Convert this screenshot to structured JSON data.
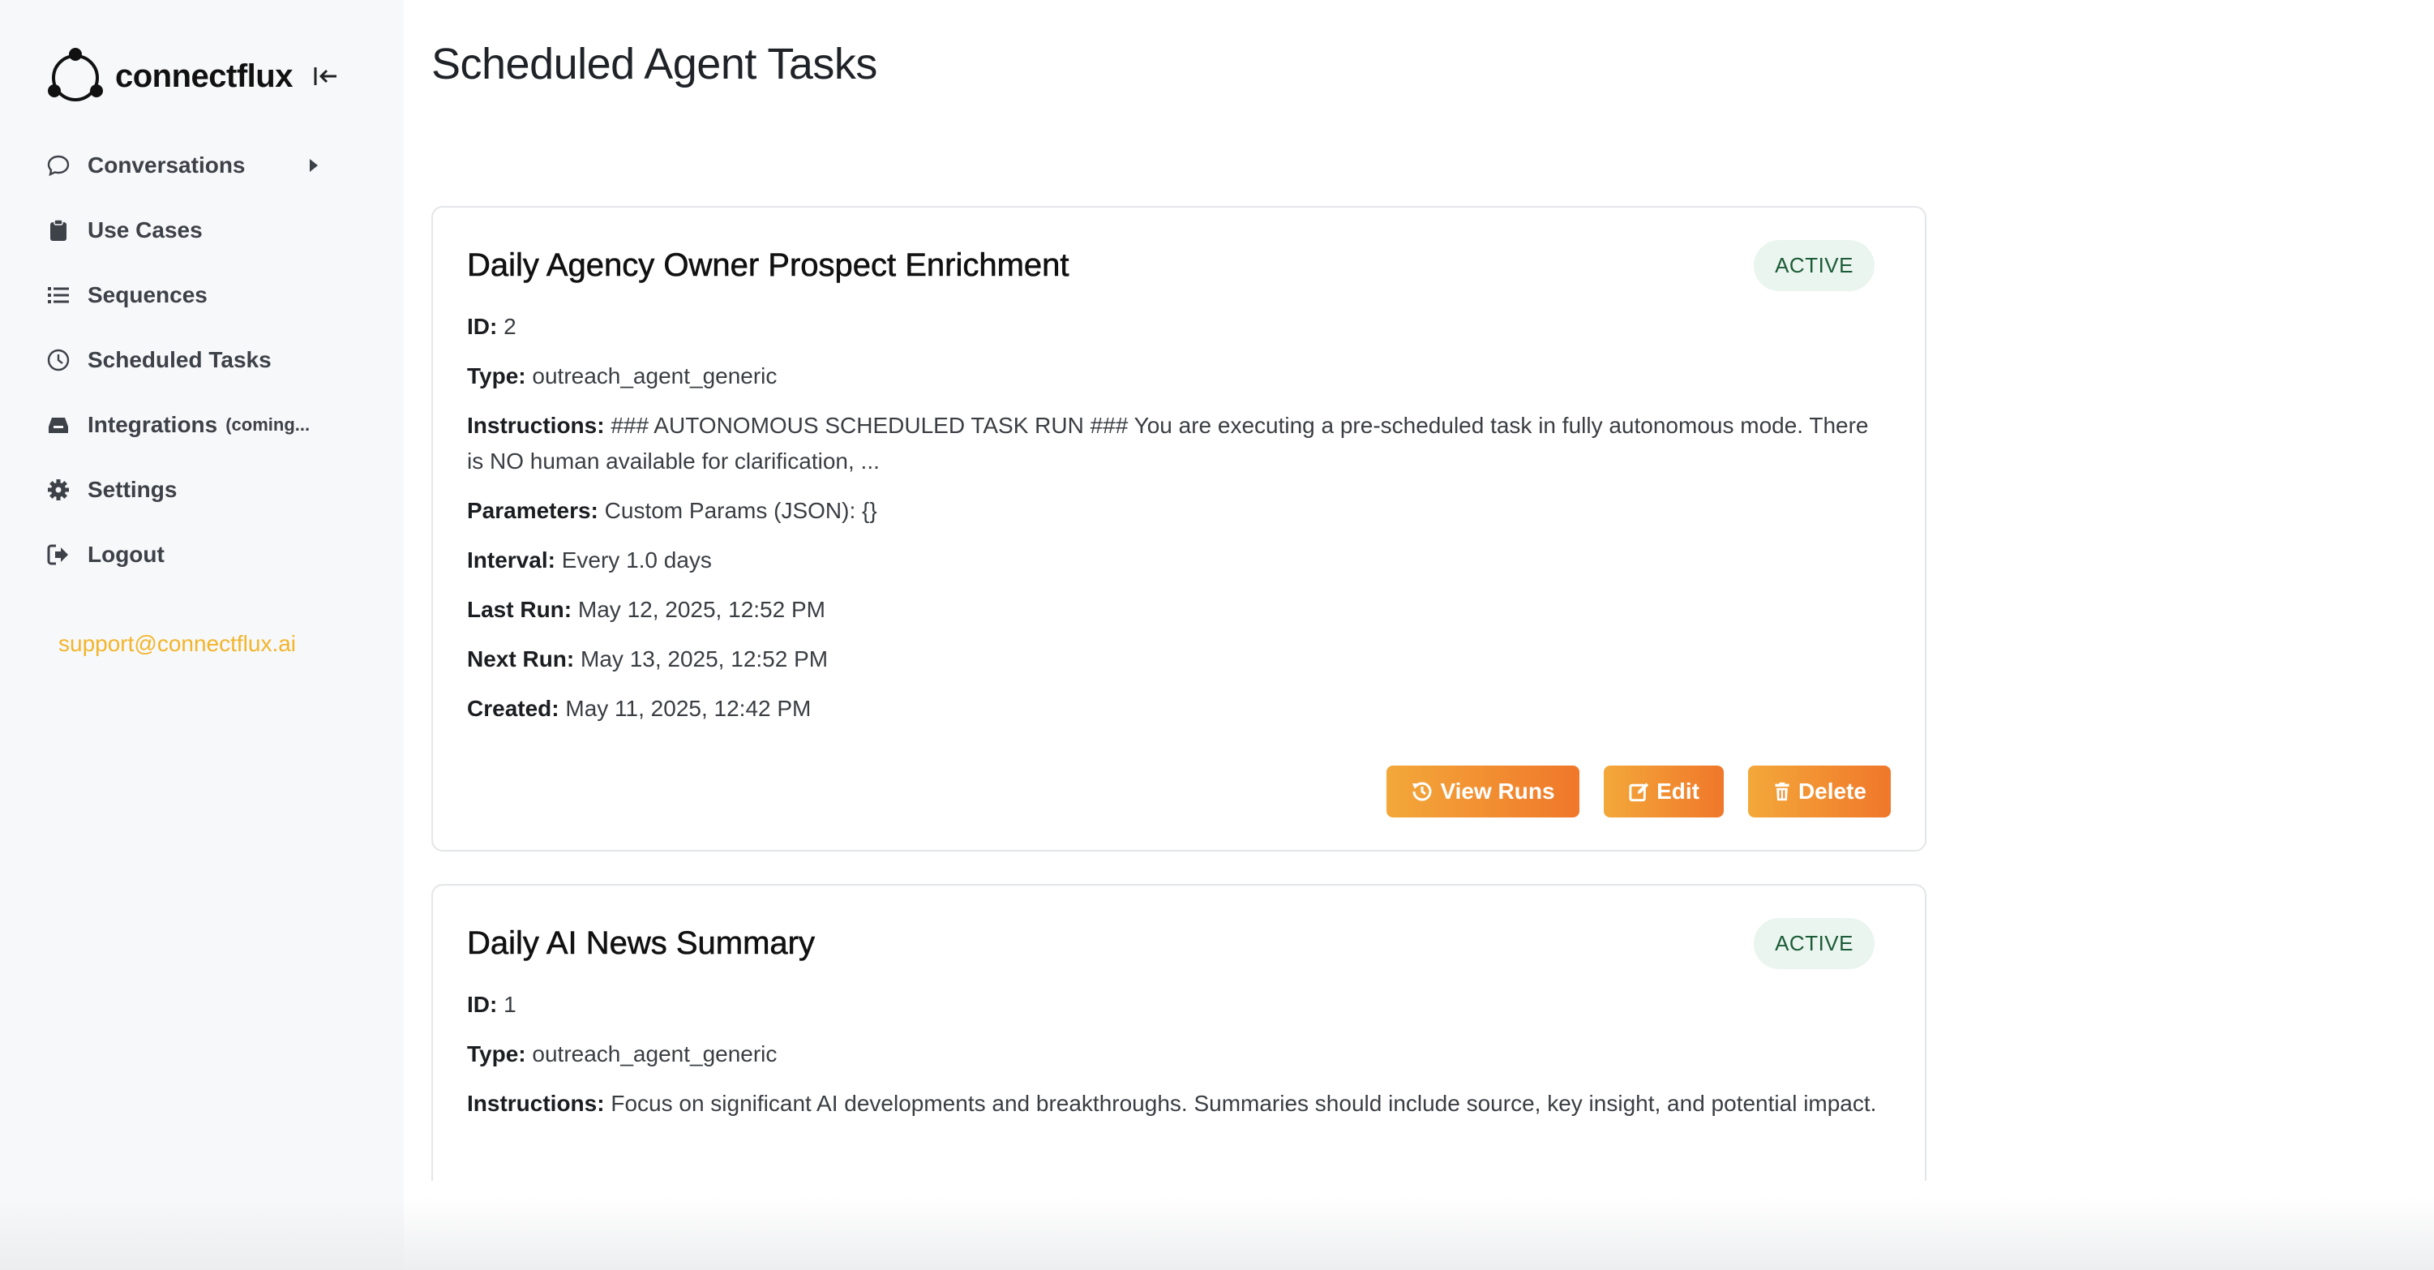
{
  "brand": {
    "name": "connectflux"
  },
  "sidebar": {
    "items": [
      {
        "label": "Conversations",
        "icon": "chat-bubble-icon"
      },
      {
        "label": "Use Cases",
        "icon": "clipboard-icon"
      },
      {
        "label": "Sequences",
        "icon": "list-icon"
      },
      {
        "label": "Scheduled Tasks",
        "icon": "clock-icon"
      },
      {
        "label": "Integrations",
        "coming": "(coming...",
        "icon": "inbox-icon"
      },
      {
        "label": "Settings",
        "icon": "gear-icon"
      },
      {
        "label": "Logout",
        "icon": "logout-icon"
      }
    ],
    "support_email": "support@connectflux.ai"
  },
  "page": {
    "title": "Scheduled Agent Tasks"
  },
  "labels": {
    "id": "ID:",
    "type": "Type:",
    "instructions": "Instructions:",
    "parameters": "Parameters:",
    "interval": "Interval:",
    "last_run": "Last Run:",
    "next_run": "Next Run:",
    "created": "Created:"
  },
  "tasks": [
    {
      "title": "Daily Agency Owner Prospect Enrichment",
      "status": "ACTIVE",
      "id": "2",
      "type": "outreach_agent_generic",
      "instructions": "### AUTONOMOUS SCHEDULED TASK RUN ### You are executing a pre-scheduled task in fully autonomous mode. There is NO human available for clarification, ...",
      "parameters": "Custom Params (JSON): {}",
      "interval": "Every 1.0 days",
      "last_run": "May 12, 2025, 12:52 PM",
      "next_run": "May 13, 2025, 12:52 PM",
      "created": "May 11, 2025, 12:42 PM"
    },
    {
      "title": "Daily AI News Summary",
      "status": "ACTIVE",
      "id": "1",
      "type": "outreach_agent_generic",
      "instructions": "Focus on significant AI developments and breakthroughs. Summaries should include source, key insight, and potential impact."
    }
  ],
  "actions": {
    "view_runs": "View Runs",
    "edit": "Edit",
    "delete": "Delete"
  },
  "colors": {
    "accent_start": "#f3a83a",
    "accent_end": "#f0772a",
    "support": "#f2b52b",
    "badge_bg": "#e9f5ee",
    "badge_text": "#1c5b37"
  }
}
